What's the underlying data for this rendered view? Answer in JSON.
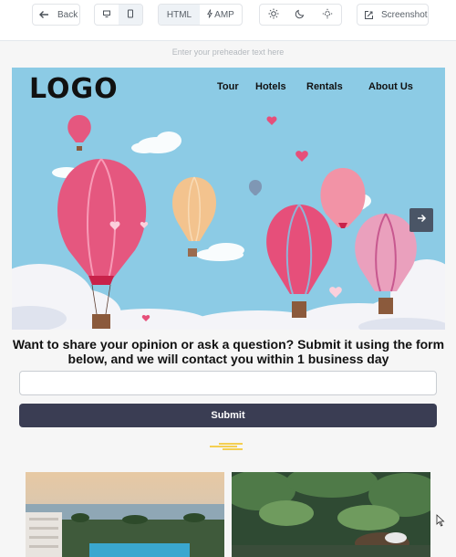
{
  "toolbar": {
    "back_label": "Back",
    "format_html": "HTML",
    "format_amp": "AMP",
    "screenshot_label": "Screenshot"
  },
  "email": {
    "preheader_placeholder": "Enter your preheader text here",
    "logo": "LOGO",
    "nav": [
      "Tour",
      "Hotels",
      "Rentals",
      "About Us"
    ],
    "form_heading": "Want to share your opinion or ask a question? Submit it using the form below, and we will contact you within 1 business day",
    "submit_label": "Submit"
  },
  "icons": {
    "back": "arrow-left-icon",
    "desktop": "desktop-icon",
    "mobile": "mobile-icon",
    "amp": "lightning-icon",
    "light_theme": "sun-icon",
    "dark_theme": "moon-icon",
    "auto_theme": "auto-theme-icon",
    "screenshot": "screenshot-icon",
    "carousel_next": "arrow-right-icon"
  },
  "colors": {
    "submit_bg": "#3a3d53",
    "sky": "#8ccbe5",
    "deco_accent": "#f3c21b"
  }
}
